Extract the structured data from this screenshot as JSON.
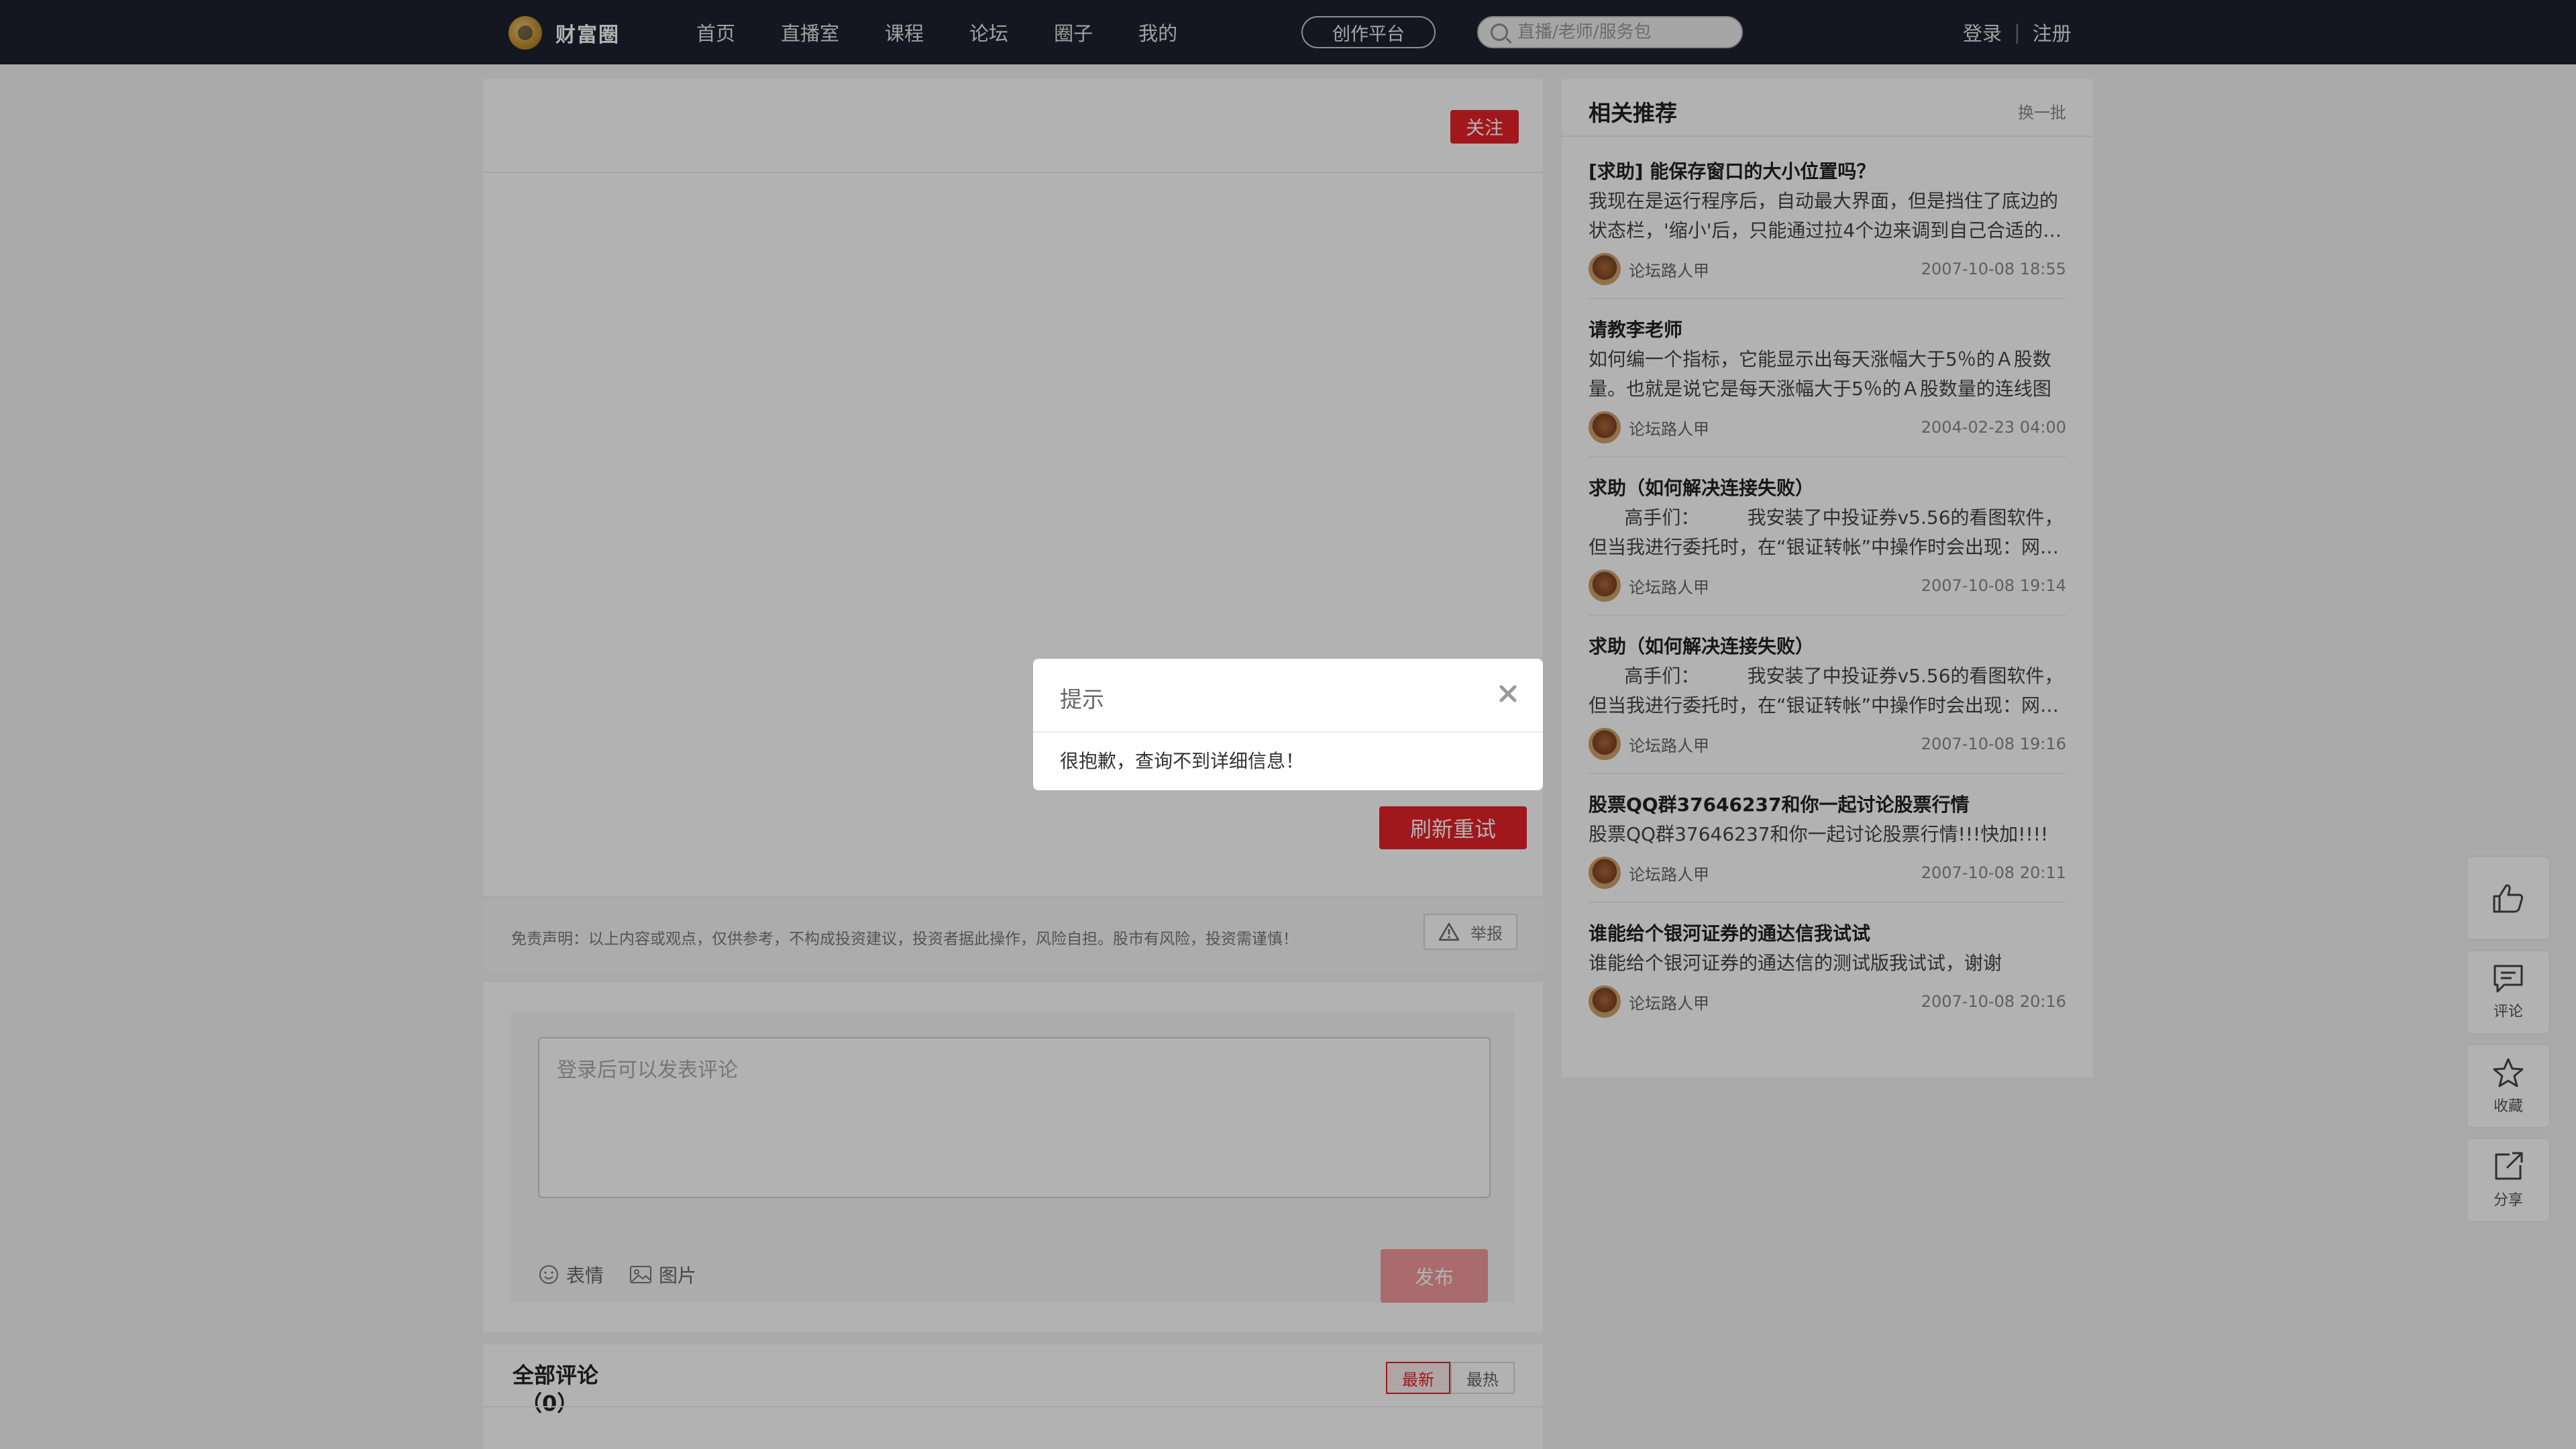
{
  "header": {
    "logo_text": "财富圈",
    "nav": [
      "首页",
      "直播室",
      "课程",
      "论坛",
      "圈子",
      "我的"
    ],
    "creator_label": "创作平台",
    "search_placeholder": "直播/老师/服务包",
    "login_label": "登录",
    "auth_separator": "|",
    "register_label": "注册"
  },
  "article": {
    "follow_label": "关注",
    "retry_label": "刷新重试",
    "disclaimer": "免责声明：以上内容或观点，仅供参考，不构成投资建议，投资者据此操作，风险自担。股市有风险，投资需谨慎！",
    "report_label": "举报"
  },
  "comment_box": {
    "placeholder": "登录后可以发表评论",
    "emoji_label": "表情",
    "image_label": "图片",
    "publish_label": "发布"
  },
  "all_comments": {
    "title": "全部评论",
    "count": "（0）",
    "tabs": [
      "最新",
      "最热"
    ],
    "active_tab": "最新"
  },
  "sidebar": {
    "title": "相关推荐",
    "refresh_label": "换一批",
    "items": [
      {
        "title": "[求助] 能保存窗口的大小位置吗？",
        "body": "我现在是运行程序后，自动最大界面，但是挡住了底边的状态栏，'缩小'后，只能通过拉4个边来调到自己合适的大小，但是下次运行又要重新调整",
        "author": "论坛路人甲",
        "time": "2007-10-08 18:55"
      },
      {
        "title": "请教李老师",
        "body": "如何编一个指标，它能显示出每天涨幅大于5％的Ａ股数量。也就是说它是每天涨幅大于5％的Ａ股数量的连线图",
        "author": "论坛路人甲",
        "time": "2004-02-23 04:00"
      },
      {
        "title": "求助（如何解决连接失败）",
        "body": "      高手们：        我安装了中投证券v5.56的看图软件，但当我进行委托时，在“银证转帐”中操作时会出现：网络连接失败",
        "author": "论坛路人甲",
        "time": "2007-10-08 19:14"
      },
      {
        "title": "求助（如何解决连接失败）",
        "body": "      高手们：        我安装了中投证券v5.56的看图软件，但当我进行委托时，在“银证转帐”中操作时会出现：网络连接失败",
        "author": "论坛路人甲",
        "time": "2007-10-08 19:16"
      },
      {
        "title": "股票QQ群37646237和你一起讨论股票行情",
        "body": "股票QQ群37646237和你一起讨论股票行情!!!快加!!!!",
        "author": "论坛路人甲",
        "time": "2007-10-08 20:11"
      },
      {
        "title": "谁能给个银河证券的通达信我试试",
        "body": "谁能给个银河证券的通达信的测试版我试试，谢谢",
        "author": "论坛路人甲",
        "time": "2007-10-08 20:16"
      }
    ]
  },
  "float_actions": {
    "like_label": "",
    "comment_label": "评论",
    "favorite_label": "收藏",
    "share_label": "分享"
  },
  "modal": {
    "title": "提示",
    "message": "很抱歉，查询不到详细信息！"
  },
  "colors": {
    "nav_bg": "#1d2230",
    "accent_red": "#e62129",
    "publish_disabled": "#f29a9d"
  }
}
